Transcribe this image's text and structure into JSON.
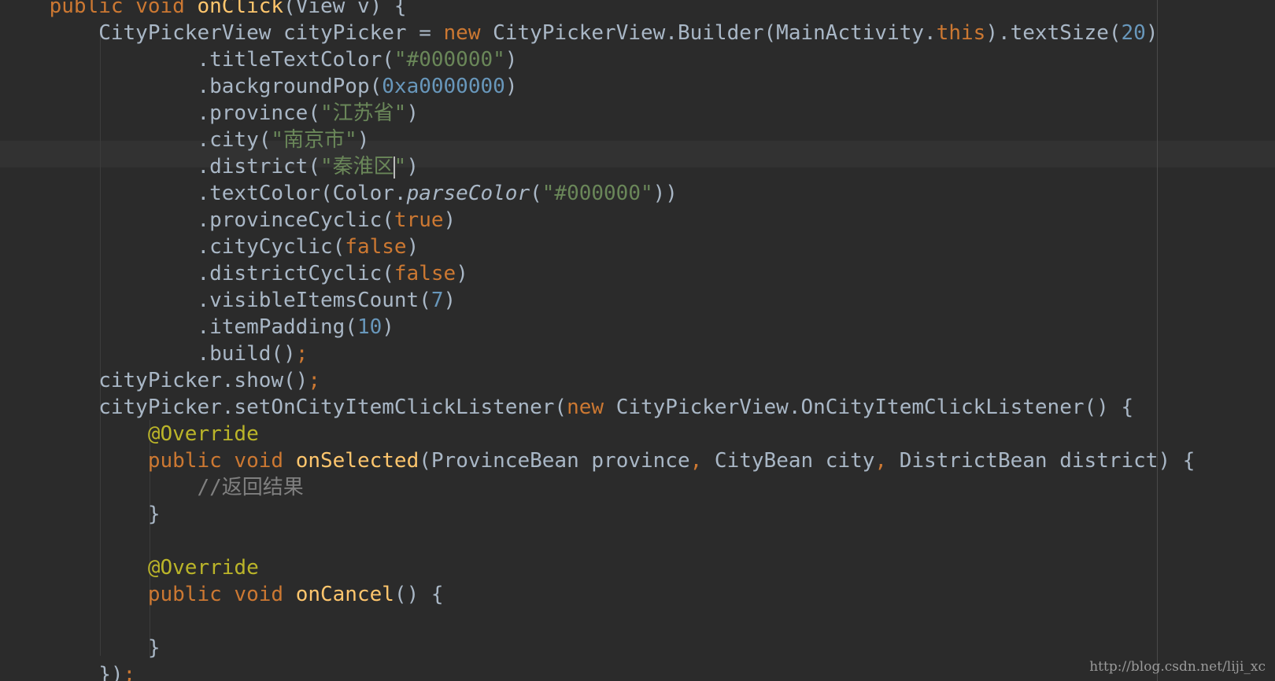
{
  "editor": {
    "caret_line_index": 5,
    "colors": {
      "background": "#2b2b2b",
      "caret_row": "#323232",
      "default_text": "#a9b7c6",
      "keyword": "#cc7832",
      "string": "#6a8759",
      "number": "#6897bb",
      "method_declaration": "#ffc66d",
      "annotation": "#bbb529",
      "comment": "#808080"
    },
    "lines": [
      [
        {
          "t": "    "
        },
        {
          "t": "public void ",
          "c": "kw"
        },
        {
          "t": "onClick",
          "c": "fn"
        },
        {
          "t": "(View v) {"
        }
      ],
      [
        {
          "t": "        CityPickerView cityPicker = "
        },
        {
          "t": "new ",
          "c": "kw"
        },
        {
          "t": "CityPickerView.Builder(MainActivity."
        },
        {
          "t": "this",
          "c": "kw"
        },
        {
          "t": ").textSize("
        },
        {
          "t": "20",
          "c": "num"
        },
        {
          "t": ")"
        }
      ],
      [
        {
          "t": "                .titleTextColor("
        },
        {
          "t": "\"#000000\"",
          "c": "str"
        },
        {
          "t": ")"
        }
      ],
      [
        {
          "t": "                .backgroundPop("
        },
        {
          "t": "0xa0000000",
          "c": "num"
        },
        {
          "t": ")"
        }
      ],
      [
        {
          "t": "                .province("
        },
        {
          "t": "\"江苏省\"",
          "c": "str"
        },
        {
          "t": ")"
        }
      ],
      [
        {
          "t": "                .city("
        },
        {
          "t": "\"南京市\"",
          "c": "str"
        },
        {
          "t": ")"
        }
      ],
      [
        {
          "t": "                .district("
        },
        {
          "t": "\"秦淮区",
          "c": "str"
        },
        {
          "caret": true
        },
        {
          "t": "\"",
          "c": "str"
        },
        {
          "t": ")"
        }
      ],
      [
        {
          "t": "                .textColor(Color."
        },
        {
          "t": "parseColor",
          "c": "it"
        },
        {
          "t": "("
        },
        {
          "t": "\"#000000\"",
          "c": "str"
        },
        {
          "t": "))"
        }
      ],
      [
        {
          "t": "                .provinceCyclic("
        },
        {
          "t": "true",
          "c": "kw"
        },
        {
          "t": ")"
        }
      ],
      [
        {
          "t": "                .cityCyclic("
        },
        {
          "t": "false",
          "c": "kw"
        },
        {
          "t": ")"
        }
      ],
      [
        {
          "t": "                .districtCyclic("
        },
        {
          "t": "false",
          "c": "kw"
        },
        {
          "t": ")"
        }
      ],
      [
        {
          "t": "                .visibleItemsCount("
        },
        {
          "t": "7",
          "c": "num"
        },
        {
          "t": ")"
        }
      ],
      [
        {
          "t": "                .itemPadding("
        },
        {
          "t": "10",
          "c": "num"
        },
        {
          "t": ")"
        }
      ],
      [
        {
          "t": "                .build()"
        },
        {
          "t": ";",
          "c": "kw"
        }
      ],
      [
        {
          "t": "        cityPicker.show()"
        },
        {
          "t": ";",
          "c": "kw"
        }
      ],
      [
        {
          "t": "        cityPicker.setOnCityItemClickListener("
        },
        {
          "t": "new ",
          "c": "kw"
        },
        {
          "t": "CityPickerView.OnCityItemClickListener() {"
        }
      ],
      [
        {
          "t": "            "
        },
        {
          "t": "@Override",
          "c": "ann"
        }
      ],
      [
        {
          "t": "            "
        },
        {
          "t": "public void ",
          "c": "kw"
        },
        {
          "t": "onSelected",
          "c": "fn"
        },
        {
          "t": "(ProvinceBean province"
        },
        {
          "t": ", ",
          "c": "kw"
        },
        {
          "t": "CityBean city"
        },
        {
          "t": ", ",
          "c": "kw"
        },
        {
          "t": "DistrictBean district) {"
        }
      ],
      [
        {
          "t": "                "
        },
        {
          "t": "//返回结果",
          "c": "cmt"
        }
      ],
      [
        {
          "t": "            }"
        }
      ],
      [
        {
          "t": ""
        }
      ],
      [
        {
          "t": "            "
        },
        {
          "t": "@Override",
          "c": "ann"
        }
      ],
      [
        {
          "t": "            "
        },
        {
          "t": "public void ",
          "c": "kw"
        },
        {
          "t": "onCancel",
          "c": "fn"
        },
        {
          "t": "() {"
        }
      ],
      [
        {
          "t": ""
        }
      ],
      [
        {
          "t": "            }"
        }
      ],
      [
        {
          "t": "        })"
        },
        {
          "t": ";",
          "c": "kw"
        }
      ],
      [
        {
          "t": "    }"
        }
      ]
    ]
  },
  "watermark": "http://blog.csdn.net/liji_xc"
}
